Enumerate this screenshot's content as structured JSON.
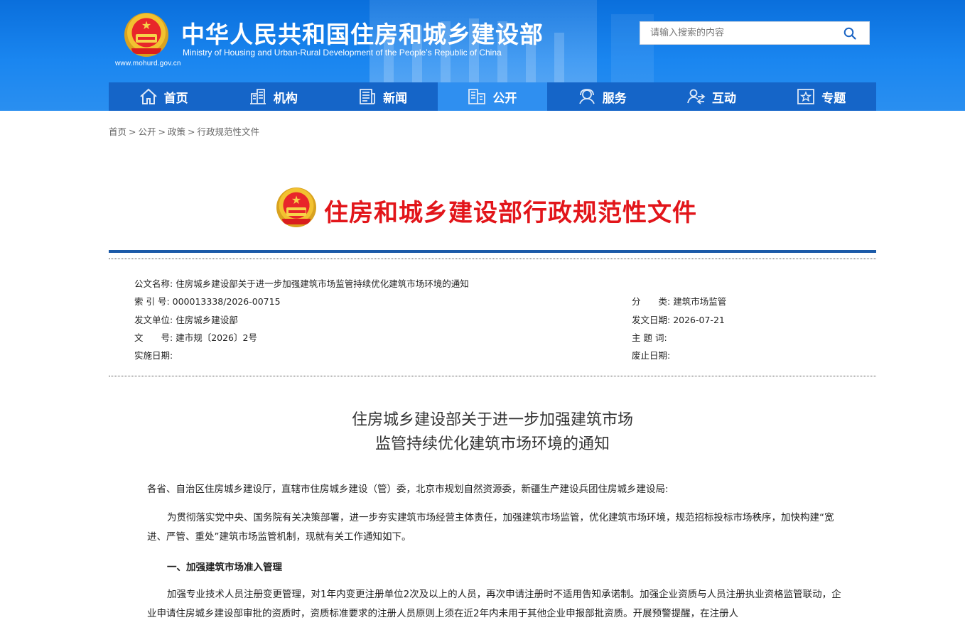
{
  "header": {
    "title_cn": "中华人民共和国住房和城乡建设部",
    "title_en": "Ministry of Housing and Urban-Rural Development of the People’s Republic of China",
    "url": "www.mohurd.gov.cn",
    "search_placeholder": "请输入搜索的内容"
  },
  "nav": {
    "items": [
      {
        "label": "首页",
        "icon": "home-icon"
      },
      {
        "label": "机构",
        "icon": "building-icon"
      },
      {
        "label": "新闻",
        "icon": "news-icon"
      },
      {
        "label": "公开",
        "icon": "disclosure-icon",
        "active": true
      },
      {
        "label": "服务",
        "icon": "service-icon"
      },
      {
        "label": "互动",
        "icon": "interact-icon"
      },
      {
        "label": "专题",
        "icon": "star-icon"
      }
    ]
  },
  "breadcrumb": [
    "首页",
    "公开",
    "政策",
    "行政规范性文件"
  ],
  "banner": {
    "title": "住房和城乡建设部行政规范性文件"
  },
  "meta": {
    "doc_name_label": "公文名称:",
    "doc_name": "住房城乡建设部关于进一步加强建筑市场监管持续优化建筑市场环境的通知",
    "index_label": "索 引 号:",
    "index": "000013338/2026-00715",
    "category_label": "分　　类:",
    "category": "建筑市场监管",
    "issuer_label": "发文单位:",
    "issuer": "住房城乡建设部",
    "date_label": "发文日期:",
    "date": "2026-07-21",
    "doc_no_label": "文　　号:",
    "doc_no": "建市规〔2026〕2号",
    "keywords_label": "主 题 词:",
    "keywords": "",
    "effective_label": "实施日期:",
    "effective": "",
    "abolished_label": "废止日期:",
    "abolished": ""
  },
  "article": {
    "title_line1": "住房城乡建设部关于进一步加强建筑市场",
    "title_line2": "监管持续优化建筑市场环境的通知",
    "salutation": "各省、自治区住房城乡建设厅，直辖市住房城乡建设（管）委，北京市规划自然资源委，新疆生产建设兵团住房城乡建设局:",
    "intro": "为贯彻落实党中央、国务院有关决策部署，进一步夯实建筑市场经营主体责任，加强建筑市场监管，优化建筑市场环境，规范招标投标市场秩序，加快构建“宽进、严管、重处”建筑市场监管机制，现就有关工作通知如下。",
    "section1_title": "一、加强建筑市场准入管理",
    "section1_p1": "加强专业技术人员注册变更管理，对1年内变更注册单位2次及以上的人员，再次申请注册时不适用告知承诺制。加强企业资质与人员注册执业资格监管联动，企业申请住房城乡建设部审批的资质时，资质标准要求的注册人员原则上须在近2年内未用于其他企业申报部批资质。开展预警提醒，在注册人"
  }
}
